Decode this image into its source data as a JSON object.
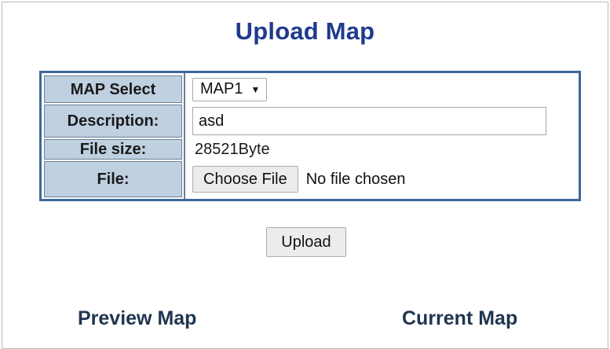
{
  "page": {
    "title": "Upload Map"
  },
  "form": {
    "map_select": {
      "label": "MAP Select",
      "selected": "MAP1"
    },
    "description": {
      "label": "Description:",
      "value": "asd"
    },
    "file_size": {
      "label": "File size:",
      "value": "28521Byte"
    },
    "file": {
      "label": "File:",
      "button_label": "Choose File",
      "status": "No file chosen"
    }
  },
  "actions": {
    "upload_label": "Upload"
  },
  "sections": {
    "preview_title": "Preview Map",
    "current_title": "Current Map"
  },
  "colors": {
    "title": "#1f3b8c",
    "table_border": "#3c689c",
    "label_bg": "#bfd0e0",
    "section_title": "#1f3550"
  },
  "icons": {
    "select_arrow": "dropdown-arrow-icon"
  }
}
